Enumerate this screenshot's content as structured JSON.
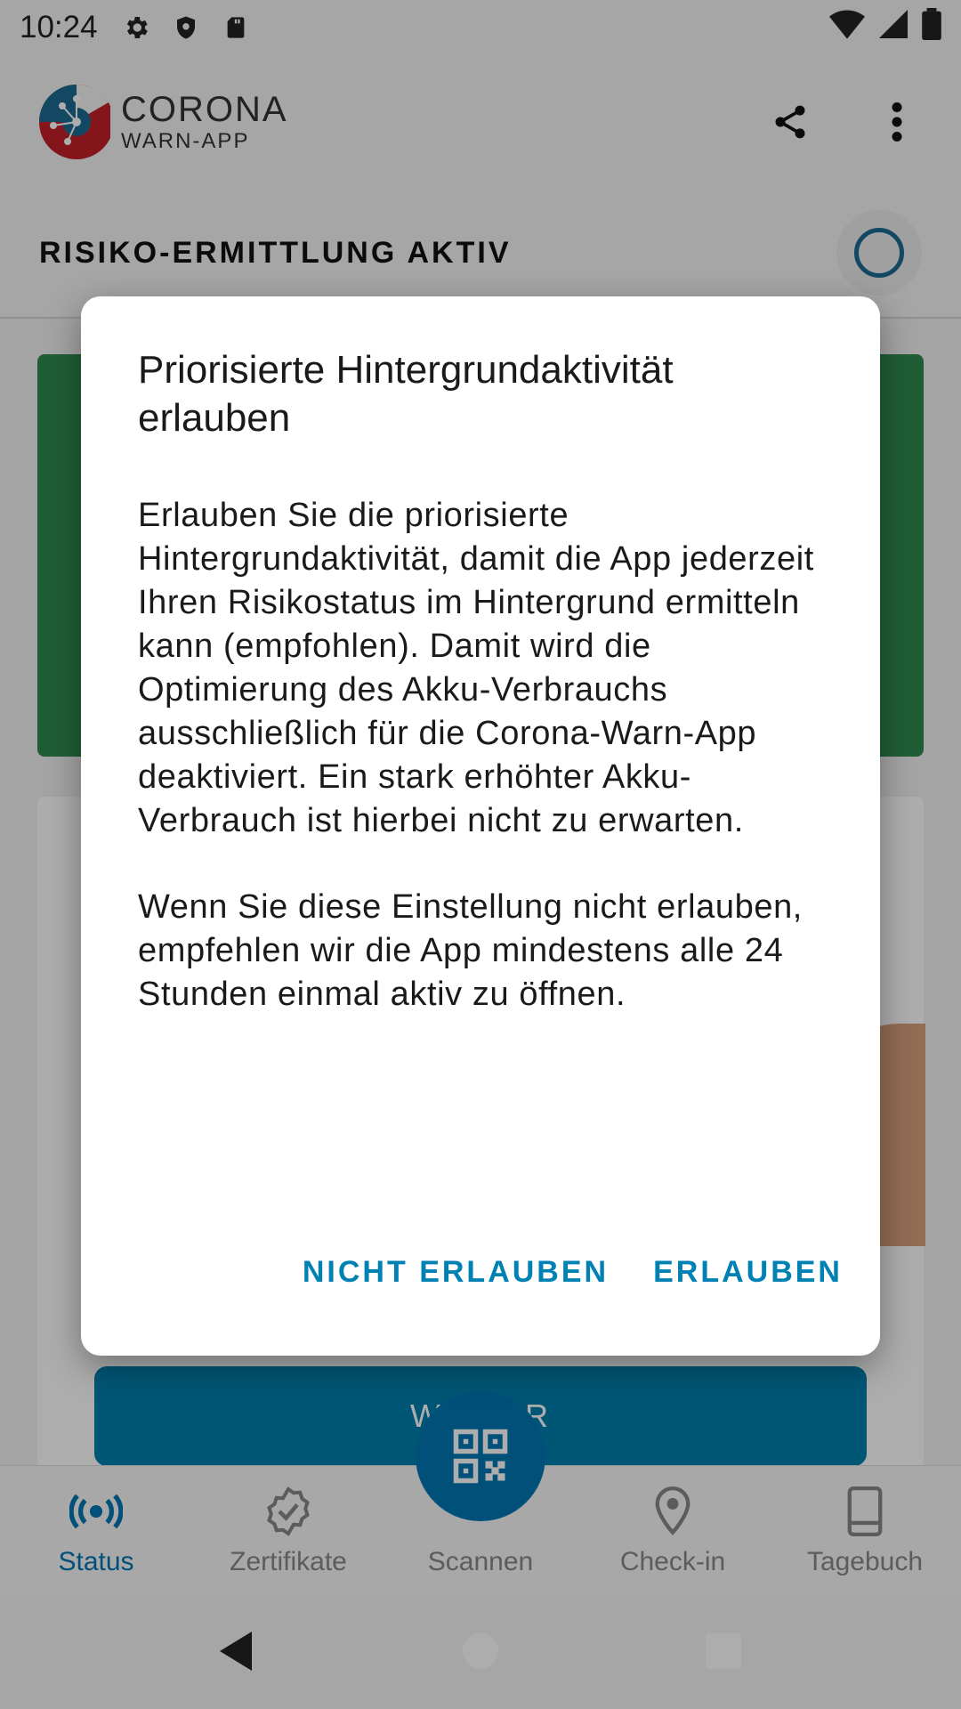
{
  "status_bar": {
    "time": "10:24"
  },
  "app": {
    "logo_line1": "CORONA",
    "logo_line2": "WARN-APP"
  },
  "risk": {
    "title": "RISIKO-ERMITTLUNG AKTIV"
  },
  "background": {
    "button_label": "WEITER"
  },
  "bottom_nav": {
    "items": [
      {
        "label": "Status",
        "icon": "status-icon"
      },
      {
        "label": "Zertifikate",
        "icon": "certificate-icon"
      },
      {
        "label": "Scannen",
        "icon": "qr-code-icon"
      },
      {
        "label": "Check-in",
        "icon": "location-pin-icon"
      },
      {
        "label": "Tagebuch",
        "icon": "diary-icon"
      }
    ]
  },
  "dialog": {
    "title": "Priorisierte Hintergrundaktivität erlauben",
    "paragraph1": "Erlauben Sie die priorisierte Hintergrundaktivität, damit die App jederzeit Ihren Risikostatus im Hintergrund ermitteln kann (empfohlen). Damit wird die Optimierung des Akku-Verbrauchs ausschließlich für die Corona-Warn-App deaktiviert. Ein stark erhöhter Akku-Verbrauch ist hierbei nicht zu erwarten.",
    "paragraph2": "Wenn Sie diese Einstellung nicht erlauben, empfehlen wir die App mindestens alle 24 Stunden einmal aktiv zu öffnen.",
    "deny_label": "NICHT ERLAUBEN",
    "allow_label": "ERLAUBEN"
  },
  "colors": {
    "accent": "#0077b3",
    "green_card": "#2e8b4f",
    "button_text": "#0081b4"
  }
}
